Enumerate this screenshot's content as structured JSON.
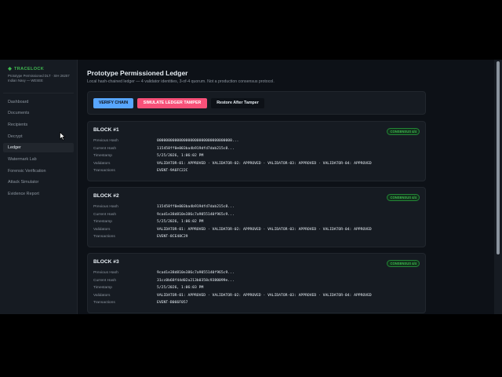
{
  "sidebar": {
    "brand": "TRACELOCK",
    "brand_sub": "Prototype Permissioned DLT · SIH 26257 Indian Navy — WESEE",
    "items": [
      {
        "label": "Dashboard"
      },
      {
        "label": "Documents"
      },
      {
        "label": "Recipients"
      },
      {
        "label": "Decrypt"
      },
      {
        "label": "Ledger",
        "active": true
      },
      {
        "label": "Watermark Lab"
      },
      {
        "label": "Forensic Verification"
      },
      {
        "label": "Attack Simulator"
      },
      {
        "label": "Evidence Report"
      }
    ]
  },
  "main": {
    "title": "Prototype Permissioned Ledger",
    "subtitle": "Local hash-chained ledger — 4 validator identities, 3-of-4 quorum. Not a production consensus protocol.",
    "buttons": {
      "verify": "VERIFY CHAIN",
      "tamper": "SIMULATE LEDGER TAMPER",
      "restore": "Restore After Tamper"
    },
    "field_labels": {
      "previous_hash": "Previous Hash",
      "current_hash": "Current Hash",
      "timestamp": "Timestamp",
      "validators": "Validators",
      "transactions": "Transactions"
    },
    "blocks": [
      {
        "title": "BLOCK #1",
        "badge": "CONSENSUS 4/4",
        "previous_hash": "0000000000000000000000000000000000...",
        "current_hash": "115458ff0e003ba4b919dfd7dab215c8...",
        "timestamp": "5/25/2026, 1:06:02 PM",
        "validators": "VALIDATOR-01: APPROVED · VALIDATOR-02: APPROVED · VALIDATOR-03: APPROVED · VALIDATOR-04: APPROVED",
        "transactions": "EVENT-9A6FC22C"
      },
      {
        "title": "BLOCK #2",
        "badge": "CONSENSUS 4/4",
        "previous_hash": "115458ff0e003ba4b919dfd7dab215c8...",
        "current_hash": "9cad1e38d810e386c7a9055140f965c9...",
        "timestamp": "5/25/2026, 1:06:02 PM",
        "validators": "VALIDATOR-01: APPROVED · VALIDATOR-02: APPROVED · VALIDATOR-03: APPROVED · VALIDATOR-04: APPROVED",
        "transactions": "EVENT-8CE48C29"
      },
      {
        "title": "BLOCK #3",
        "badge": "CONSENSUS 4/4",
        "previous_hash": "9cad1e38d810e386c7a9055140f965c9...",
        "current_hash": "31cc0b68f44d02a213b0358c9380099e...",
        "timestamp": "5/25/2026, 1:06:03 PM",
        "validators": "VALIDATOR-01: APPROVED · VALIDATOR-02: APPROVED · VALIDATOR-03: APPROVED · VALIDATOR-04: APPROVED",
        "transactions": "EVENT-B066F057"
      }
    ]
  },
  "colors": {
    "accent": "#3fb950",
    "verify": "#58a6ff",
    "tamper": "#f85179",
    "background": "#0d1117"
  }
}
